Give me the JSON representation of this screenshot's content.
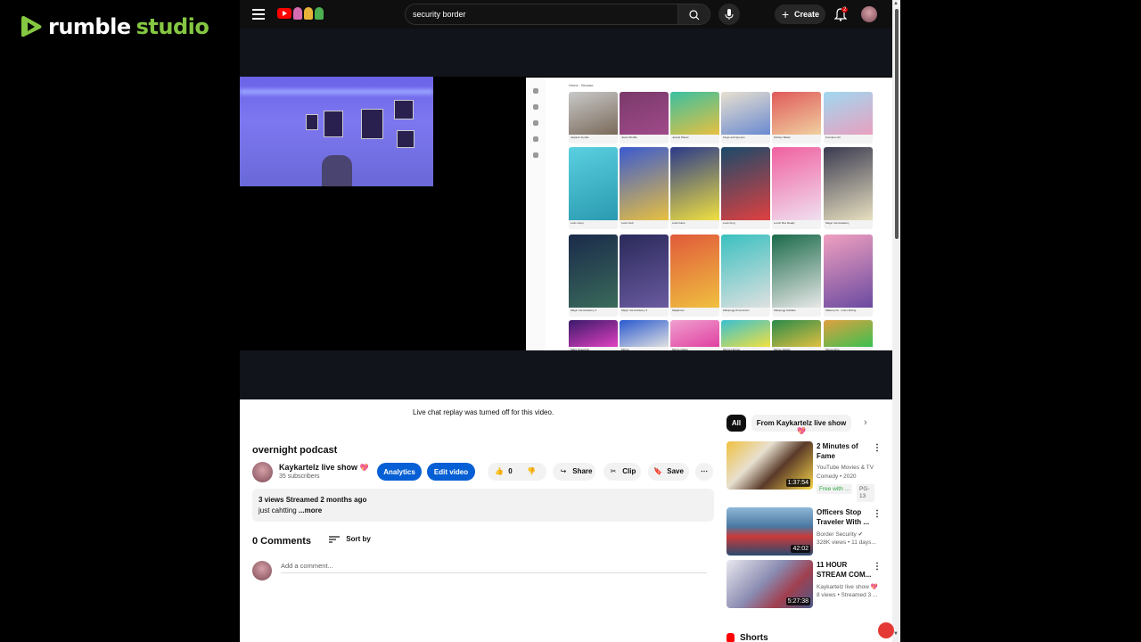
{
  "brand": {
    "word1": "rumble",
    "word2": "studio",
    "accent": "#85c742"
  },
  "topbar": {
    "search_value": "security border",
    "create_label": "Create",
    "notification_count": "2"
  },
  "player": {
    "game_breadcrumb": "Home · Browse",
    "tiles": [
      "Jetpack Joyride",
      "Jewel Shuffle",
      "Jewels Planet",
      "Kings and Queens",
      "Kitchen Bazar",
      "Knockem All",
      "Ludo Jump",
      "Ludo Club",
      "Ludo Karts",
      "Ludo King",
      "Lunch Box Ready",
      "Magic Cat Academy",
      "Magic Cat Academy 2",
      "Magic Cat Academy 3",
      "Magikmon",
      "Mahjongg Dimensions",
      "Mahjongg Solitaire",
      "Makeup Kit - Color Mixing",
      "Maze Speedrun",
      "Merge",
      "Merge Cakes",
      "Merge Heroes",
      "Merge Jewels",
      "Merge Dino"
    ]
  },
  "below": {
    "chat_note": "Live chat replay was turned off for this video.",
    "title": "overnight podcast",
    "channel_name": "Kaykartelz live show",
    "channel_subs": "35 subscribers",
    "analytics_label": "Analytics",
    "edit_label": "Edit video",
    "like_count": "0",
    "share_label": "Share",
    "clip_label": "Clip",
    "save_label": "Save",
    "desc_meta": "3 views  Streamed 2 months ago",
    "desc_body": "just cahtting ",
    "desc_more": "...more",
    "comments_heading": "0 Comments",
    "sort_label": "Sort by",
    "add_comment_placeholder": "Add a comment..."
  },
  "sidebar": {
    "chip_all": "All",
    "chip_from": "From Kaykartelz live show",
    "recs": [
      {
        "title": "2 Minutes of Fame",
        "line1": "YouTube Movies & TV",
        "line2": "Comedy • 2020",
        "duration": "1:37:54",
        "badge_free": "Free with ...",
        "badge_rating": "PG-13"
      },
      {
        "title": "Officers Stop Traveler With ...",
        "line1": "Border Security",
        "line2": "328K views • 11 days...",
        "duration": "42:02"
      },
      {
        "title": "11 HOUR STREAM COM...",
        "line1": "Kaykartelz live show",
        "line2": "8 views • Streamed 3 ...",
        "duration": "5:27:38"
      }
    ],
    "shorts_label": "Shorts"
  }
}
